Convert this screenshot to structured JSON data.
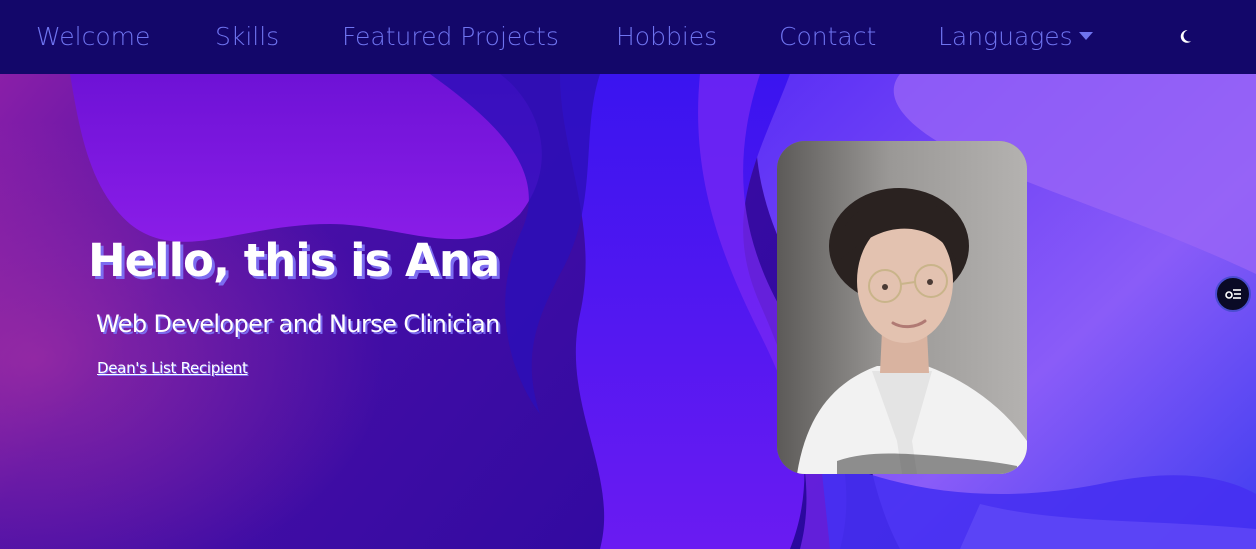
{
  "nav": {
    "items": [
      {
        "label": "Welcome"
      },
      {
        "label": "Skills"
      },
      {
        "label": "Featured Projects"
      },
      {
        "label": "Hobbies"
      },
      {
        "label": "Contact"
      },
      {
        "label": "Languages"
      }
    ],
    "theme_icon": "moon-icon"
  },
  "hero": {
    "title": "Hello, this is Ana",
    "subtitle": "Web Developer and Nurse Clinician",
    "link": "Dean's List Recipient"
  },
  "side_button_icon": "accessibility-menu-icon",
  "colors": {
    "navbar_bg": "#13076a",
    "nav_link": "#6f74f0",
    "hero_purple": "#7a14e6",
    "hero_blue": "#3b2cf2",
    "text": "#ffffff"
  }
}
